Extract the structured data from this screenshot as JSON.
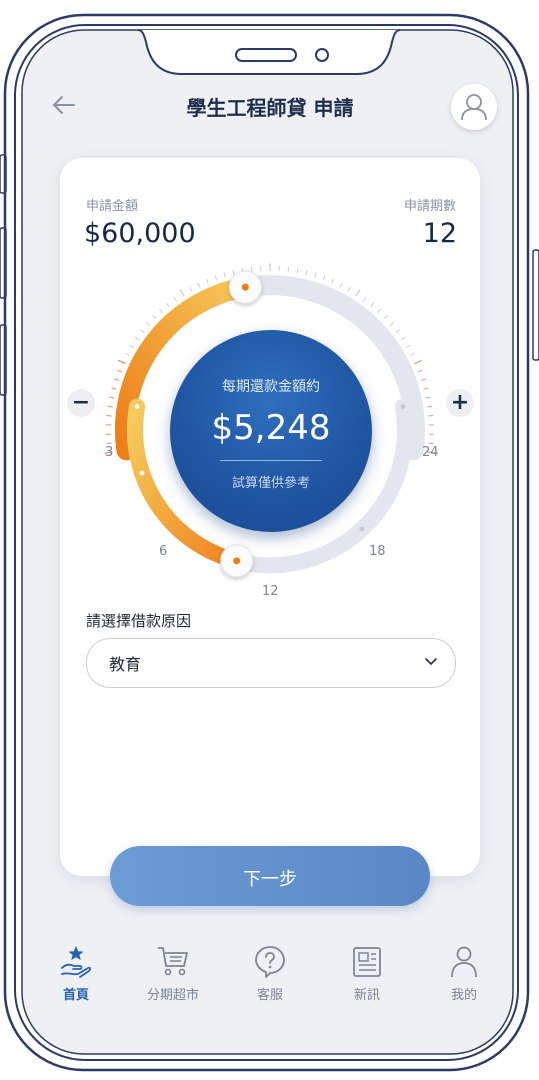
{
  "header": {
    "title": "學生工程師貸 申請"
  },
  "loan": {
    "amount_label": "申請金額",
    "amount_value": "$60,000",
    "periods_label": "申請期數",
    "periods_value": "12"
  },
  "dial": {
    "center_label": "每期還款金額約",
    "payment": "$5,248",
    "note": "試算僅供參考",
    "period_ticks": [
      "3",
      "6",
      "12",
      "18",
      "24"
    ],
    "selected_period": 12,
    "amount_level_fraction": 0.45,
    "minus": "−",
    "plus": "+"
  },
  "reason": {
    "label": "請選擇借款原因",
    "selected": "教育"
  },
  "next_button": {
    "label": "下一步"
  },
  "bottom_nav": [
    {
      "label": "首頁",
      "icon": "home-hand-star-icon",
      "active": true
    },
    {
      "label": "分期超市",
      "icon": "shopping-cart-icon",
      "active": false
    },
    {
      "label": "客服",
      "icon": "help-bubble-icon",
      "active": false
    },
    {
      "label": "新訊",
      "icon": "news-icon",
      "active": false
    },
    {
      "label": "我的",
      "icon": "person-icon",
      "active": false
    }
  ],
  "colors": {
    "primary_blue": "#1f54a1",
    "accent_orange": "#f08a1e",
    "accent_yellow": "#f3c24d",
    "button_blue": "#6a98d2",
    "nav_active": "#2b61b3"
  }
}
